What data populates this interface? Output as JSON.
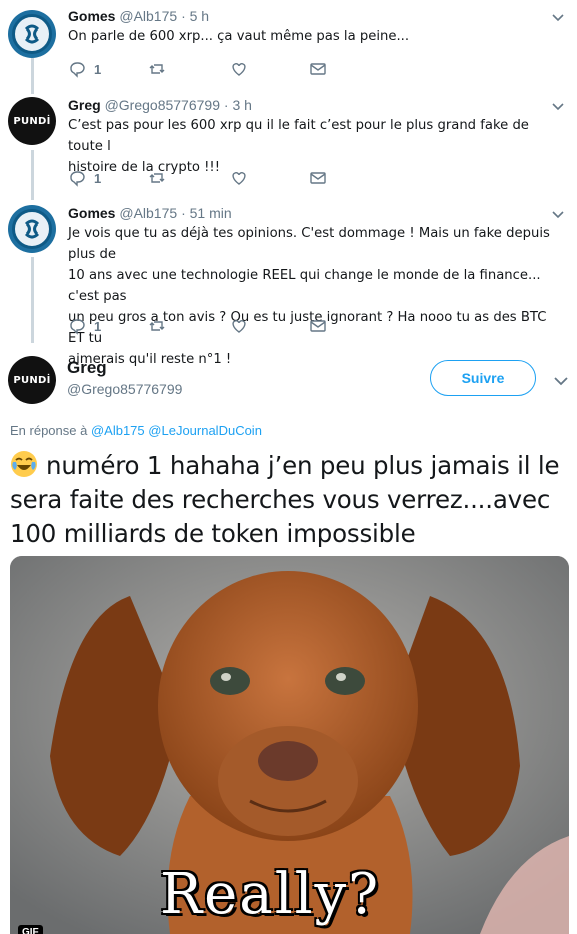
{
  "replies": [
    {
      "name": "Gomes",
      "handle": "@Alb175",
      "time": "5 h",
      "text": "On parle de 600 xrp... ça vaut même pas la peine...",
      "reply_count": "1",
      "avatar": "ripple-logo"
    },
    {
      "name": "Greg",
      "handle": "@Grego85776799",
      "time": "3 h",
      "text_lines": [
        "C’est pas pour les 600 xrp qu il le fait  c’est pour le plus grand fake de toute l",
        "histoire de la crypto !!!"
      ],
      "reply_count": "1",
      "avatar_text": "PUNDİ"
    },
    {
      "name": "Gomes",
      "handle": "@Alb175",
      "time": "51 min",
      "text_lines": [
        "Je vois que tu as déjà tes opinions. C'est dommage ! Mais un fake depuis plus de",
        "10 ans avec une technologie REEL qui change le monde de la finance... c'est pas",
        "un peu gros a ton avis ? Ou es tu juste ignorant ? Ha nooo tu as des BTC ET tu",
        "aimerais qu'il reste n°1 !"
      ],
      "reply_count": "1",
      "avatar": "ripple-logo"
    }
  ],
  "dot": "·",
  "main": {
    "name": "Greg",
    "handle": "@Grego85776799",
    "avatar_text": "PUNDİ",
    "follow_label": "Suivre",
    "in_reply_prefix": "En réponse à",
    "mentions": [
      "@Alb175",
      "@LeJournalDuCoin"
    ],
    "emoji": "face-with-tears-of-joy",
    "text_lines": [
      "numéro 1 hahaha j’en peu plus jamais il le",
      "sera faite des recherches vous verrez....avec",
      "100 milliards de token impossible"
    ],
    "media_caption": "Really?",
    "media_badge": "GIF"
  },
  "icons": [
    "reply-icon",
    "retweet-icon",
    "like-icon",
    "dm-icon",
    "chevron-down-icon"
  ],
  "colors": {
    "accent": "#1da1f2",
    "muted": "#657786",
    "thread_line": "#ccd6dd"
  }
}
